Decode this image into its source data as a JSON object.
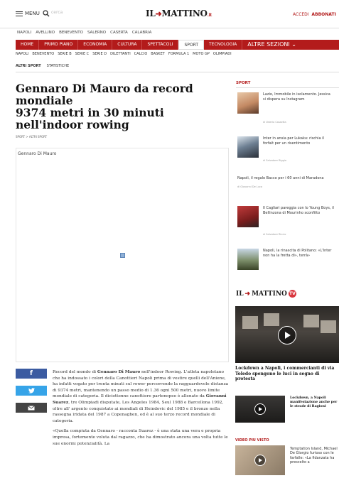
{
  "header": {
    "menu_label": "MENU",
    "search_placeholder": "cerca",
    "logo_left": "IL",
    "logo_right": "MATTINO",
    "logo_suffix": ".it",
    "login_label": "ACCEDI",
    "subscribe_label": "ABBONATI"
  },
  "cities": [
    "NAPOLI",
    "AVELLINO",
    "BENEVENTO",
    "SALERNO",
    "CASERTA",
    "CALABRIA"
  ],
  "main_nav": [
    {
      "label": "HOME",
      "active": false
    },
    {
      "label": "PRIMO PIANO",
      "active": false
    },
    {
      "label": "ECONOMIA",
      "active": false
    },
    {
      "label": "CULTURA",
      "active": false
    },
    {
      "label": "SPETTACOLI",
      "active": false
    },
    {
      "label": "SPORT",
      "active": true
    },
    {
      "label": "TECNOLOGIA",
      "active": false
    }
  ],
  "main_nav_more": "ALTRE SEZIONI",
  "sub_nav": [
    "NAPOLI",
    "BENEVENTO",
    "SERIE B",
    "SERIE C",
    "SERIE D",
    "DILETTANTI",
    "CALCIO",
    "BASKET",
    "FORMULA 1",
    "MOTO GP",
    "OLIMPIADI"
  ],
  "sub_nav2": [
    "ALTRI SPORT",
    "STATISTICHE"
  ],
  "article": {
    "headline_1": "Gennaro Di Mauro da record mondiale",
    "headline_2": "9374 metri in 30 minuti",
    "headline_3": "nell'indoor rowing",
    "kicker": "SPORT > ALTRI SPORT",
    "media_caption": "Gennaro Di Mauro",
    "p1_a": "Record del mondo di ",
    "p1_b": "Gennaro Di Mauro",
    "p1_c": " nell'indoor Rowing. L'atleta napoletano che ha indossato i colori della Canottieri Napoli prima di vestire quelli dell'Aniene, ha infatti vogato per trenta minuti sul rower percorrendo la ragguardevole distanza di 9374 metri, mantenendo un passo medio di 1.36 ogni 500 metri, nuovo limite mondiale di categoria. Il diciottenne canottiere partenopeo  è allenato da ",
    "p1_d": "Giovanni Suarez",
    "p1_e": ", tre Olimpiadi disputate, Los Angeles 1984, Seul 1988 e Barcellona 1992, oltre all' argento conquistato ai mondiali di Heindovic del 1985 e il bronzo nella rassegna iridata del 1987 a Copenaghen, ed è al suo terzo record mondiale di categoria.",
    "p2": "«Quella compiuta da Gennaro - racconta Suarez - è una stata una vera e propria impresa, fortemente voluta dal ragazzo, che ha dimostrato ancora una volta tutte le sue enormi potenzialità. La"
  },
  "share": [
    {
      "name": "facebook",
      "icon": "f"
    },
    {
      "name": "twitter",
      "icon": "twitter-bird"
    },
    {
      "name": "email",
      "icon": "envelope"
    }
  ],
  "sidebar": {
    "section": "SPORT",
    "items": [
      {
        "title": "Lazio, Immobile in isolamento. Jessica si dispera su Instagram",
        "author": "di Valerio Cassetta"
      },
      {
        "title": "Inter in ansia per Lukaku: rischia il forfait per un risentimento",
        "author": "di Salvatore Riggio"
      },
      {
        "title": "Napoli, il regalo Bacco per i 60 anni di Maradona",
        "author": "di Giovanni De Luca"
      },
      {
        "title": "Il Cagliari pareggia con lo Young Boys, il Bellinzona di Mourinho sconfitto",
        "author": "di Salvatore Riccio"
      },
      {
        "title": "Napoli, la rinascita di Politano: «L'Inter non ha la fretta di», terrà»",
        "author": ""
      }
    ]
  },
  "tv": {
    "logo_left": "IL",
    "logo_right": "MATTINO",
    "badge": "TV",
    "main_title": "Lockdown a Napoli, i commercianti di via Toledo spengono le luci in segno di protesta",
    "second_title": "Lockdown, a Napoli manifestazione anche per le strade di Ragioni",
    "most_viewed_label": "VIDEO PIU VISTO",
    "third_title": "Temptation Island, Michael De Giorgio furioso con le farfalle: «La fidanzata ha prescelto a"
  }
}
